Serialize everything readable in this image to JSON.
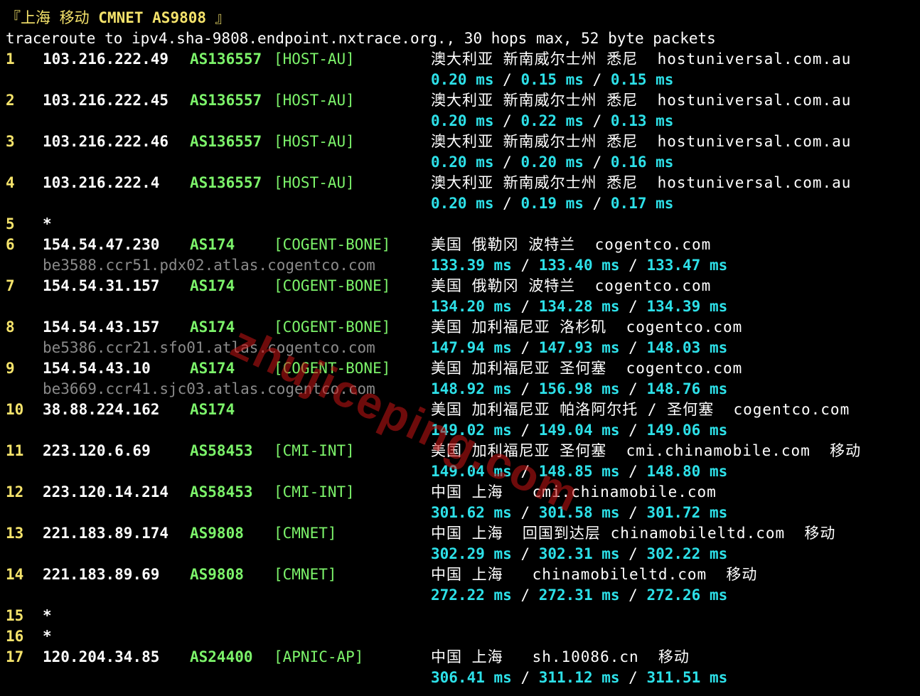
{
  "header": {
    "title_cn": "『上海 移动 ",
    "title_net": "CMNET AS9808",
    "title_close": " 』",
    "command": "traceroute to ipv4.sha-9808.endpoint.nxtrace.org., 30 hops max, 52 byte packets"
  },
  "hops": [
    {
      "hop": "1",
      "ip": "103.216.222.49",
      "asn": "AS136557",
      "tag": "[HOST-AU]",
      "geo": "澳大利亚 新南威尔士州 悉尼  hostuniversal.com.au",
      "rdns": "",
      "rtt": [
        "0.20 ms",
        "0.15 ms",
        "0.15 ms"
      ]
    },
    {
      "hop": "2",
      "ip": "103.216.222.45",
      "asn": "AS136557",
      "tag": "[HOST-AU]",
      "geo": "澳大利亚 新南威尔士州 悉尼  hostuniversal.com.au",
      "rdns": "",
      "rtt": [
        "0.20 ms",
        "0.22 ms",
        "0.13 ms"
      ]
    },
    {
      "hop": "3",
      "ip": "103.216.222.46",
      "asn": "AS136557",
      "tag": "[HOST-AU]",
      "geo": "澳大利亚 新南威尔士州 悉尼  hostuniversal.com.au",
      "rdns": "",
      "rtt": [
        "0.20 ms",
        "0.20 ms",
        "0.16 ms"
      ]
    },
    {
      "hop": "4",
      "ip": "103.216.222.4",
      "asn": "AS136557",
      "tag": "[HOST-AU]",
      "geo": "澳大利亚 新南威尔士州 悉尼  hostuniversal.com.au",
      "rdns": "",
      "rtt": [
        "0.20 ms",
        "0.19 ms",
        "0.17 ms"
      ]
    },
    {
      "hop": "5",
      "ip": "*",
      "asn": "",
      "tag": "",
      "geo": "",
      "rdns": "",
      "rtt": []
    },
    {
      "hop": "6",
      "ip": "154.54.47.230",
      "asn": "AS174",
      "tag": "[COGENT-BONE]",
      "geo": "美国 俄勒冈 波特兰  cogentco.com",
      "rdns": "be3588.ccr51.pdx02.atlas.cogentco.com",
      "rtt": [
        "133.39 ms",
        "133.40 ms",
        "133.47 ms"
      ]
    },
    {
      "hop": "7",
      "ip": "154.54.31.157",
      "asn": "AS174",
      "tag": "[COGENT-BONE]",
      "geo": "美国 俄勒冈 波特兰  cogentco.com",
      "rdns": "",
      "rtt": [
        "134.20 ms",
        "134.28 ms",
        "134.39 ms"
      ]
    },
    {
      "hop": "8",
      "ip": "154.54.43.157",
      "asn": "AS174",
      "tag": "[COGENT-BONE]",
      "geo": "美国 加利福尼亚 洛杉矶  cogentco.com",
      "rdns": "be5386.ccr21.sfo01.atlas.cogentco.com",
      "rtt": [
        "147.94 ms",
        "147.93 ms",
        "148.03 ms"
      ]
    },
    {
      "hop": "9",
      "ip": "154.54.43.10",
      "asn": "AS174",
      "tag": "[COGENT-BONE]",
      "geo": "美国 加利福尼亚 圣何塞  cogentco.com",
      "rdns": "be3669.ccr41.sjc03.atlas.cogentco.com",
      "rtt": [
        "148.92 ms",
        "156.98 ms",
        "148.76 ms"
      ]
    },
    {
      "hop": "10",
      "ip": "38.88.224.162",
      "asn": "AS174",
      "tag": "",
      "geo": "美国 加利福尼亚 帕洛阿尔托 / 圣何塞  cogentco.com",
      "rdns": "",
      "rtt": [
        "149.02 ms",
        "149.04 ms",
        "149.06 ms"
      ]
    },
    {
      "hop": "11",
      "ip": "223.120.6.69",
      "asn": "AS58453",
      "tag": "[CMI-INT]",
      "geo": "美国 加利福尼亚 圣何塞  cmi.chinamobile.com  移动",
      "rdns": "",
      "rtt": [
        "149.04 ms",
        "148.85 ms",
        "148.80 ms"
      ]
    },
    {
      "hop": "12",
      "ip": "223.120.14.214",
      "asn": "AS58453",
      "tag": "[CMI-INT]",
      "geo": "中国 上海   cmi.chinamobile.com",
      "rdns": "",
      "rtt": [
        "301.62 ms",
        "301.58 ms",
        "301.72 ms"
      ]
    },
    {
      "hop": "13",
      "ip": "221.183.89.174",
      "asn": "AS9808",
      "tag": "[CMNET]",
      "geo": "中国 上海  回国到达层 chinamobileltd.com  移动",
      "rdns": "",
      "rtt": [
        "302.29 ms",
        "302.31 ms",
        "302.22 ms"
      ]
    },
    {
      "hop": "14",
      "ip": "221.183.89.69",
      "asn": "AS9808",
      "tag": "[CMNET]",
      "geo": "中国 上海   chinamobileltd.com  移动",
      "rdns": "",
      "rtt": [
        "272.22 ms",
        "272.31 ms",
        "272.26 ms"
      ]
    },
    {
      "hop": "15",
      "ip": "*",
      "asn": "",
      "tag": "",
      "geo": "",
      "rdns": "",
      "rtt": []
    },
    {
      "hop": "16",
      "ip": "*",
      "asn": "",
      "tag": "",
      "geo": "",
      "rdns": "",
      "rtt": []
    },
    {
      "hop": "17",
      "ip": "120.204.34.85",
      "asn": "AS24400",
      "tag": "[APNIC-AP]",
      "geo": "中国 上海   sh.10086.cn  移动",
      "rdns": "",
      "rtt": [
        "306.41 ms",
        "311.12 ms",
        "311.51 ms"
      ]
    }
  ],
  "watermark": "zhujiceping.com",
  "colors": {
    "background": "#000000",
    "hop_number": "#f5e36b",
    "ip": "#ffffff",
    "asn": "#7cf36a",
    "rtt": "#2de0e8",
    "rdns": "#8a8a8a",
    "watermark": "#c81414"
  }
}
